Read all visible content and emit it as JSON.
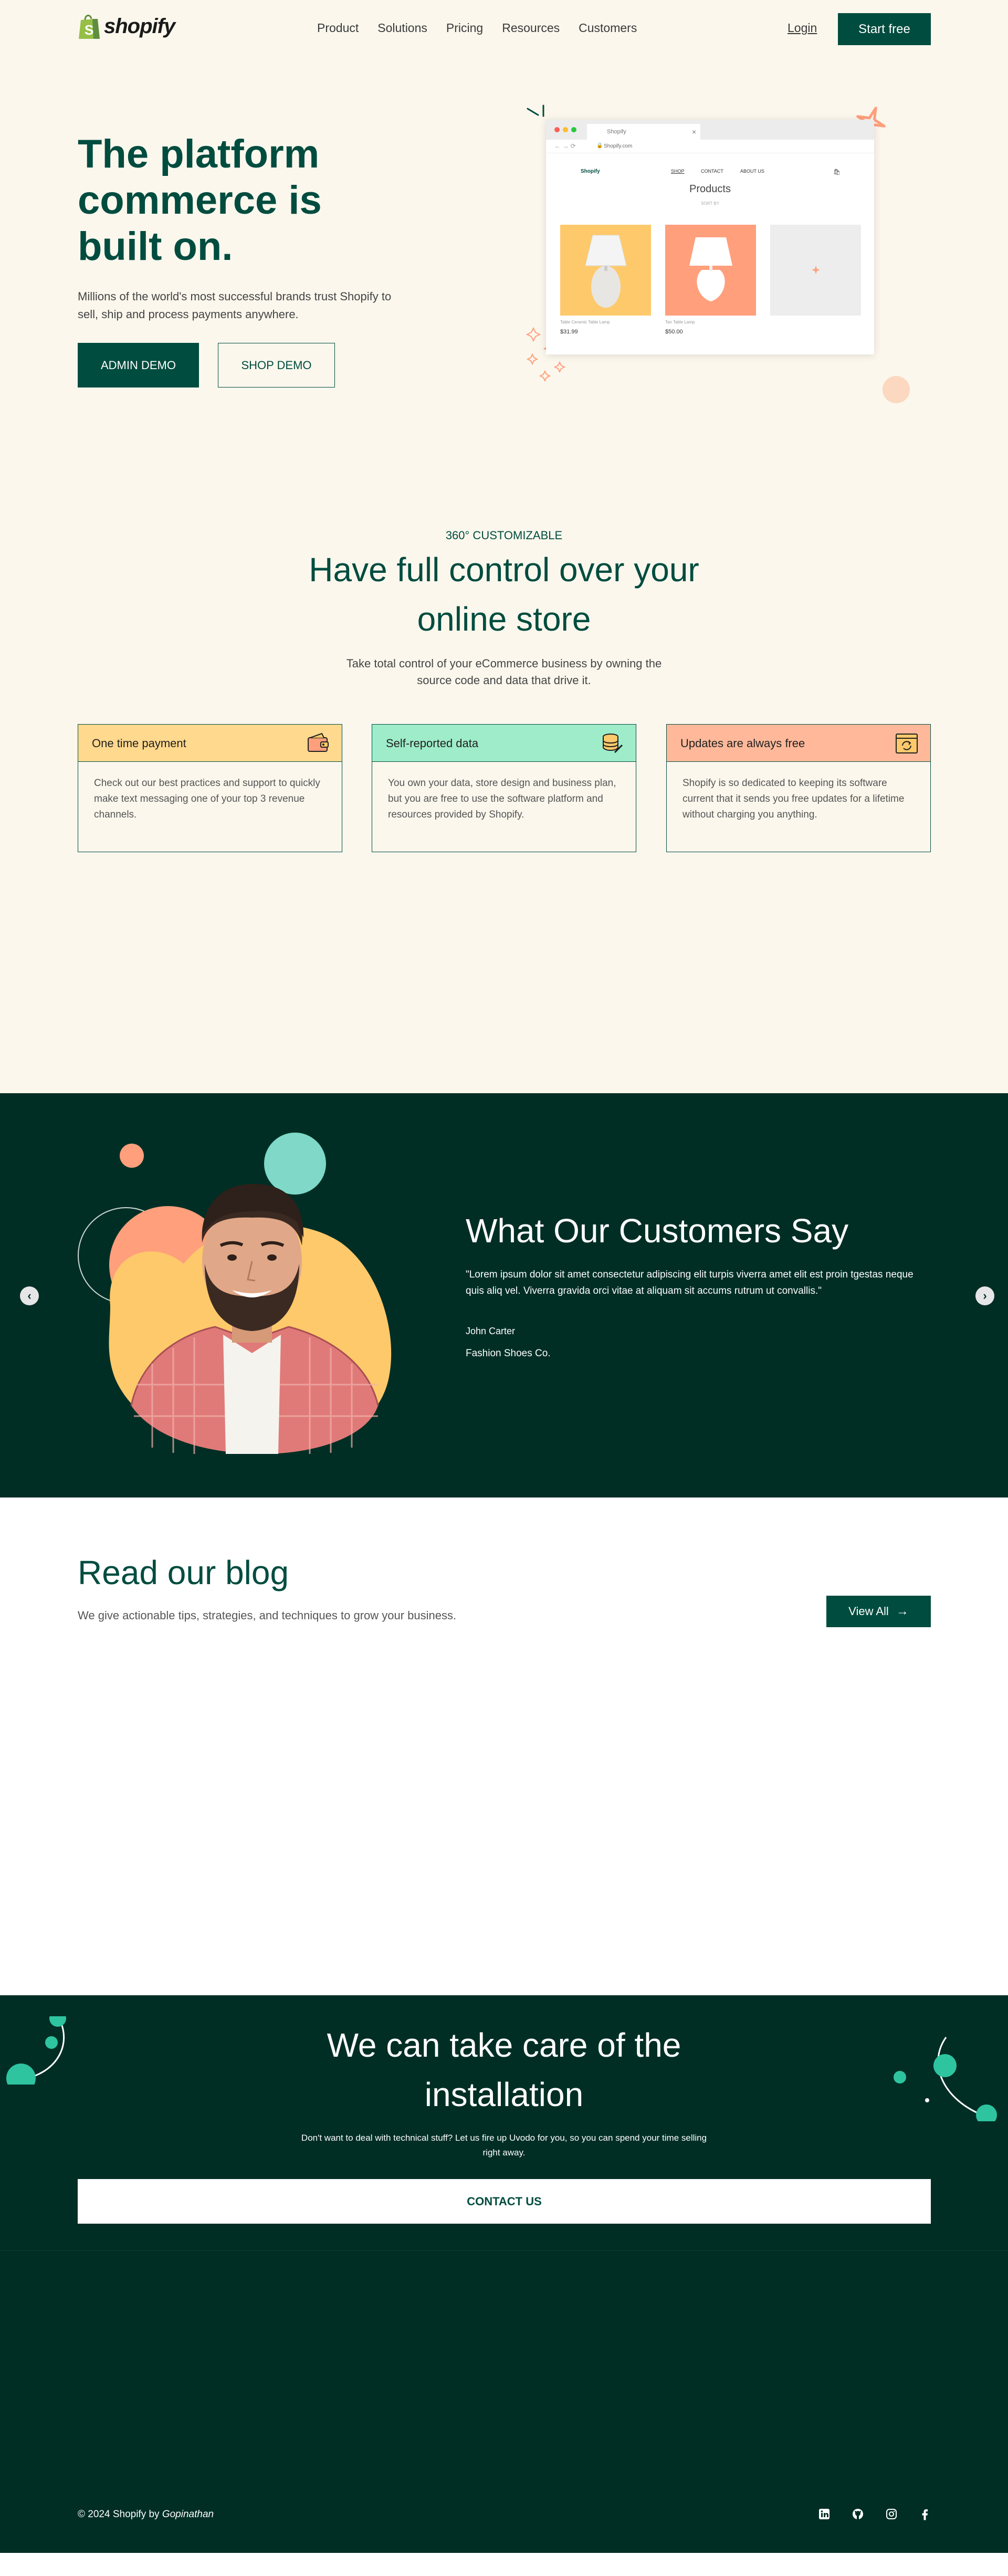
{
  "nav": {
    "logo_text": "shopify",
    "links": [
      "Product",
      "Solutions",
      "Pricing",
      "Resources",
      "Customers"
    ],
    "login": "Login",
    "start": "Start free"
  },
  "hero": {
    "title": "The platform commerce is built on.",
    "subtitle": "Millions of the world's most successful brands trust Shopify to sell, ship and process payments anywhere.",
    "admin_demo": "ADMIN DEMO",
    "shop_demo": "SHOP DEMO",
    "mockup": {
      "tab": "Shopify",
      "url": "Shopify.com",
      "brand": "Shopify",
      "nav": [
        "SHOP",
        "CONTACT",
        "ABOUT US"
      ],
      "heading": "Products",
      "crumb": "SORT BY",
      "products": [
        {
          "name": "Table Ceramic Table Lamp",
          "price": "$31.99",
          "color": "#fec96b"
        },
        {
          "name": "Tan Table Lamp",
          "price": "$50.00",
          "color": "#ff9f7c"
        }
      ]
    }
  },
  "features": {
    "eyebrow": "360° CUSTOMIZABLE",
    "title": "Have full control over your online store",
    "subtitle": "Take total control of your eCommerce business by owning the source code and data that drive it.",
    "cards": [
      {
        "title": "One time payment",
        "icon": "wallet-icon",
        "color": "#ffd98e",
        "body": "Check out our best practices and support to quickly make text messaging one of your top 3 revenue channels."
      },
      {
        "title": "Self-reported data",
        "icon": "coins-icon",
        "color": "#9eecc9",
        "body": "You own your data, store design and business plan, but you are free to use the software platform and resources provided by Shopify."
      },
      {
        "title": "Updates are always free",
        "icon": "refresh-window-icon",
        "color": "#ffb99a",
        "body": "Shopify is so dedicated to keeping its software current that it sends you free updates for a lifetime without charging you anything."
      }
    ]
  },
  "testimonial": {
    "title": "What Our Customers Say",
    "quote": "\"Lorem ipsum dolor sit amet consectetur adipiscing elit turpis viverra amet elit est proin tgestas neque quis aliq vel. Viverra gravida orci vitae at aliquam sit accums rutrum ut convallis.\"",
    "name": "John Carter",
    "company": "Fashion Shoes Co."
  },
  "blog": {
    "title": "Read our blog",
    "subtitle": "We give actionable tips, strategies, and techniques to grow your business.",
    "view_all": "View All"
  },
  "cta": {
    "title": "We can take care of the installation",
    "subtitle": "Don't want to deal with technical stuff? Let us fire up Uvodo for you, so you can spend your time selling right away.",
    "button": "CONTACT US"
  },
  "footer": {
    "copyright": "© 2024 Shopify by",
    "author": "Gopinathan",
    "social": [
      "linkedin-icon",
      "github-icon",
      "instagram-icon",
      "facebook-icon"
    ]
  },
  "colors": {
    "brand": "#004c3f",
    "dark": "#002e25",
    "cream": "#fbf7ed",
    "accent_teal": "#2ec4a0",
    "accent_orange": "#ff9f7c"
  }
}
